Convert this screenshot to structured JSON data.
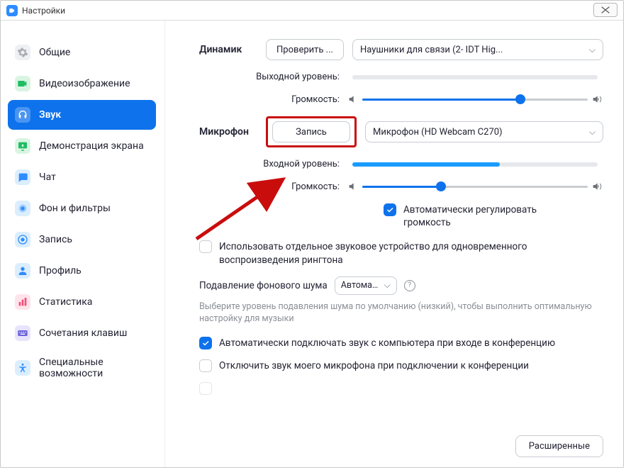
{
  "window": {
    "title": "Настройки"
  },
  "sidebar": {
    "items": [
      {
        "label": "Общие"
      },
      {
        "label": "Видеоизображение"
      },
      {
        "label": "Звук"
      },
      {
        "label": "Демонстрация экрана"
      },
      {
        "label": "Чат"
      },
      {
        "label": "Фон и фильтры"
      },
      {
        "label": "Запись"
      },
      {
        "label": "Профиль"
      },
      {
        "label": "Статистика"
      },
      {
        "label": "Сочетания клавиш"
      },
      {
        "label": "Специальные возможности"
      }
    ]
  },
  "speaker": {
    "section": "Динамик",
    "test_label": "Проверить ...",
    "device": "Наушники для связи (2- IDT Hig...",
    "output_level_label": "Выходной уровень:",
    "output_level_pct": 0,
    "volume_label": "Громкость:",
    "volume_pct": 70
  },
  "mic": {
    "section": "Микрофон",
    "record_label": "Запись",
    "device": "Микрофон (HD Webcam C270)",
    "input_level_label": "Входной уровень:",
    "input_level_pct": 60,
    "volume_label": "Громкость:",
    "volume_pct": 35,
    "auto_gain": {
      "checked": true,
      "label": "Автоматически регулировать громкость"
    }
  },
  "options": {
    "separate_ringtone": {
      "checked": false,
      "label": "Использовать отдельное звуковое устройство для одновременного воспроизведения рингтона"
    },
    "noise_label": "Подавление фонового шума",
    "noise_value": "Автомат...",
    "noise_hint": "Выберите уровень подавления шума по умолчанию (низкий), чтобы выполнить оптимальную настройку для музыки",
    "auto_join": {
      "checked": true,
      "label": "Автоматически подключать звук с компьютера при входе в конференцию"
    },
    "mute_on_join": {
      "checked": false,
      "label": "Отключить звук моего микрофона при подключении к конференции"
    }
  },
  "advanced_label": "Расширенные"
}
